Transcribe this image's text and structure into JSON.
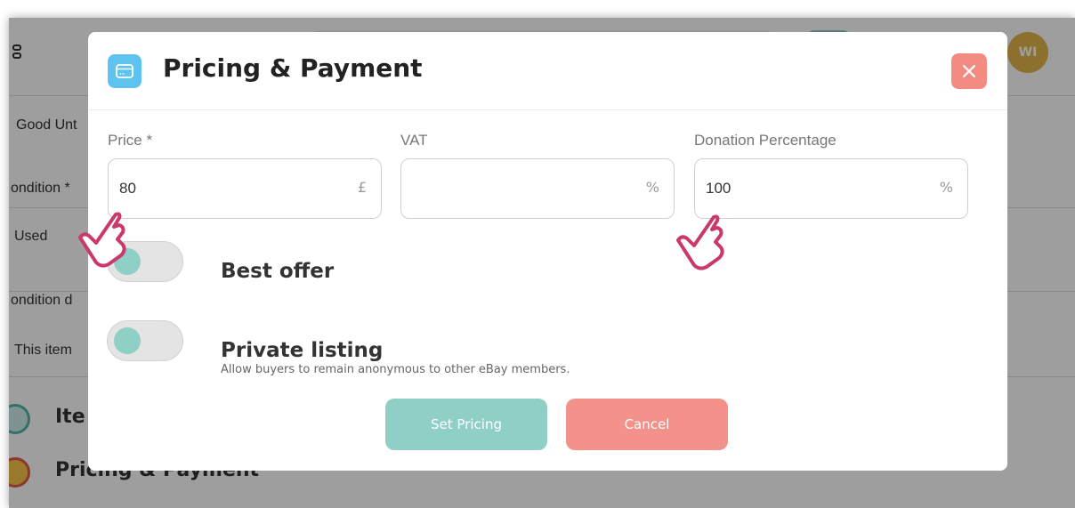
{
  "background": {
    "row_labels": [
      "Good Unt",
      "ondition *",
      "Used",
      "ondition d",
      "This item"
    ],
    "steps": [
      {
        "label": "Ite"
      },
      {
        "label": "Pricing & Payment"
      }
    ],
    "avatar_initials": "WI"
  },
  "modal": {
    "title": "Pricing & Payment",
    "header_icon": "card-icon",
    "close_icon": "close-icon",
    "fields": [
      {
        "label": "Price *",
        "value": "80",
        "suffix": "£"
      },
      {
        "label": "VAT",
        "value": "",
        "suffix": "%"
      },
      {
        "label": "Donation Percentage",
        "value": "100",
        "suffix": "%"
      }
    ],
    "toggles": [
      {
        "label": "Best offer"
      },
      {
        "label": "Private listing",
        "description": "Allow buyers to remain anonymous to other eBay members."
      }
    ],
    "buttons": {
      "primary": "Set Pricing",
      "cancel": "Cancel"
    }
  },
  "colors": {
    "accent_teal": "#8fcfc5",
    "header_icon_blue": "#5ec3ee",
    "cancel_salmon": "#f3928a",
    "close_red": "#f38b83",
    "cursor_pink": "#c93a6a",
    "avatar_gold": "#e3b54a"
  }
}
